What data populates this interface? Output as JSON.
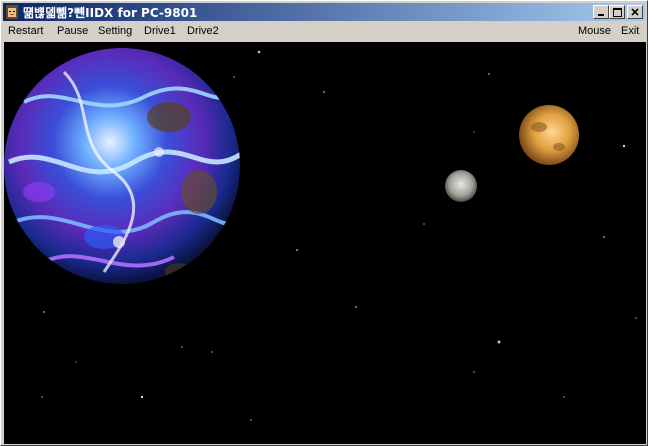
{
  "window": {
    "title": "떎뱮덻뼮?뺸IIDX for PC-9801",
    "icon": "character-face-icon",
    "buttons": [
      "minimize-icon",
      "maximize-icon",
      "close-icon"
    ]
  },
  "menu": {
    "left": [
      "Restart",
      "Pause",
      "Setting",
      "Drive1",
      "Drive2"
    ],
    "right": [
      "Mouse",
      "Exit"
    ]
  },
  "scene": {
    "background": "#000000",
    "objects": [
      "large-blue-planet",
      "small-orange-moon",
      "small-grey-moon",
      "stars"
    ]
  },
  "colors": {
    "titlebar_start": "#0a246a",
    "titlebar_end": "#a6caf0",
    "chrome": "#d4d0c8"
  }
}
